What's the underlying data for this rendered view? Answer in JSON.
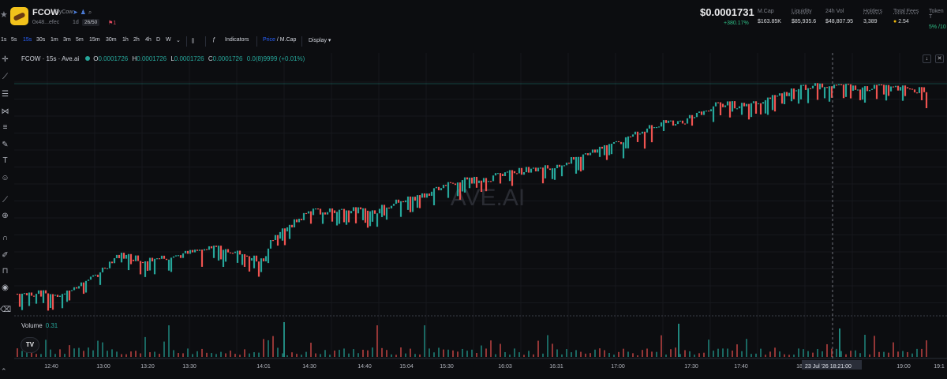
{
  "header": {
    "symbol": "FCOW",
    "token_name": "FlyCow",
    "address": "0x48...efec",
    "age": "1d",
    "rank": "26/50",
    "flag_count": "1",
    "price": "$0.0001731",
    "price_change": "+380.17%",
    "stats": [
      {
        "label": "M.Cap",
        "value": "$163.85K"
      },
      {
        "label": "Liquidity",
        "value": "$85,935.6"
      },
      {
        "label": "24h Vol",
        "value": "$48,807.95"
      },
      {
        "label": "Holders",
        "value": "3,389"
      },
      {
        "label": "Total Fees",
        "value": "2.54"
      },
      {
        "label": "Token T",
        "value": "5% /10"
      }
    ]
  },
  "toolbar": {
    "timeframes": [
      "1s",
      "5s",
      "15s",
      "30s",
      "1m",
      "3m",
      "5m",
      "15m",
      "30m",
      "1h",
      "2h",
      "4h",
      "D",
      "W"
    ],
    "active_timeframe": "15s",
    "indicators_label": "Indicators",
    "price_label": "Price",
    "mcap_label": "M.Cap",
    "display_label": "Display"
  },
  "legend": {
    "title": "FCOW · 15s · Ave.ai",
    "open": "0.0001726",
    "high": "0.0001726",
    "low": "0.0001726",
    "close": "0.0001726",
    "change": "0.0(8)9999 (+0.01%)",
    "volume_label": "Volume",
    "volume_value": "0.31"
  },
  "watermark": "AVE.AI",
  "crosshair": {
    "date_label": "23 Jul '26",
    "time_label": "18:21:00"
  },
  "colors": {
    "up": "#26a69a",
    "down": "#ef5350",
    "background": "#0c0d10",
    "accent": "#2962ff"
  },
  "chart_data": {
    "type": "candlestick",
    "x_ticks": [
      "12:40",
      "13:00",
      "13:20",
      "13:30",
      "14:01",
      "14:30",
      "14:40",
      "15:04",
      "15:30",
      "16:03",
      "16:31",
      "17:00",
      "17:30",
      "17:40",
      "18",
      "19:00",
      "19:1"
    ],
    "price_start": 3.75e-05,
    "price_last": 0.0001731,
    "series": [
      {
        "name": "Candles",
        "points": [
          [
            0.0,
            0.0
          ],
          [
            0.05,
            0.0
          ],
          [
            0.08,
            0.06
          ],
          [
            0.11,
            0.18
          ],
          [
            0.14,
            0.16
          ],
          [
            0.18,
            0.18
          ],
          [
            0.22,
            0.22
          ],
          [
            0.27,
            0.15
          ],
          [
            0.28,
            0.25
          ],
          [
            0.32,
            0.38
          ],
          [
            0.36,
            0.39
          ],
          [
            0.39,
            0.38
          ],
          [
            0.42,
            0.43
          ],
          [
            0.44,
            0.45
          ],
          [
            0.48,
            0.52
          ],
          [
            0.52,
            0.54
          ],
          [
            0.55,
            0.57
          ],
          [
            0.58,
            0.58
          ],
          [
            0.62,
            0.64
          ],
          [
            0.65,
            0.68
          ],
          [
            0.7,
            0.79
          ],
          [
            0.73,
            0.8
          ],
          [
            0.77,
            0.88
          ],
          [
            0.8,
            0.88
          ],
          [
            0.82,
            0.9
          ],
          [
            0.84,
            0.92
          ],
          [
            0.87,
            0.97
          ],
          [
            0.9,
            0.96
          ],
          [
            0.93,
            0.96
          ],
          [
            1.0,
            0.95
          ]
        ]
      }
    ],
    "volume_peaks": [
      0.31
    ]
  },
  "icons": [
    "star-icon",
    "telegram-icon",
    "person-icon",
    "search-icon",
    "chevron-down-icon",
    "crosshair-icon",
    "trendline-icon",
    "brush-icon",
    "text-icon",
    "emoji-icon",
    "ruler-icon",
    "zoom-icon",
    "magnet-icon",
    "lock-icon",
    "eye-icon",
    "trash-icon"
  ]
}
